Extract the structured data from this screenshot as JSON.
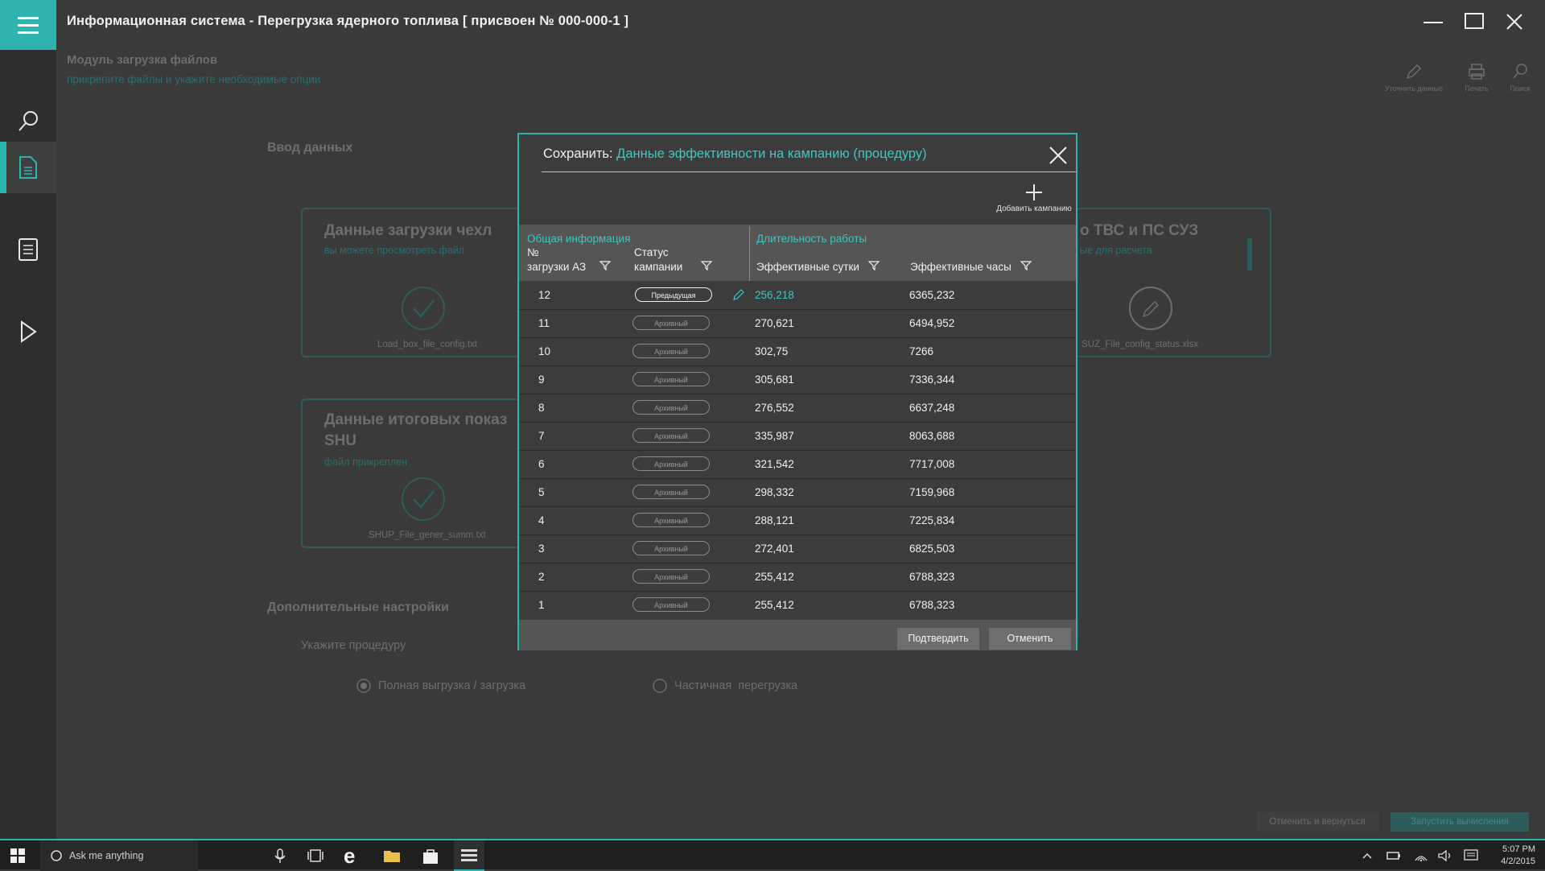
{
  "titlebar": {
    "title": "Информационная система - Перегрузка ядерного топлива [ присвоен № 000-000-1 ]"
  },
  "module": {
    "title": "Модуль загрузка файлов",
    "subtitle": "прикрепите файлы и укажите необходимые опции"
  },
  "toolbar": {
    "refine_label": "Уточнить данные",
    "print_label": "Печать",
    "search_label": "Поиск"
  },
  "input_section": {
    "title": "Ввод данных"
  },
  "cards": {
    "card1": {
      "title": "Данные загрузки чехл",
      "hint": "вы можете просмотреть файл",
      "file": "Load_box_file_config.txt"
    },
    "card2": {
      "title": "Данные итоговых показ",
      "title2": "SHU",
      "hint": "файл прикреплен",
      "file": "SHUP_File_gener_summ.txt"
    },
    "card3": {
      "title": "о ТВС и ПС СУЗ",
      "hint": "ые для расчета",
      "file": "SUZ_File_config_status.xlsx"
    }
  },
  "extra": {
    "title": "Дополнительные настройки",
    "procedure_label": "Укажите процедуру",
    "option_full": "Полная выгрузка / загрузка",
    "option_partial": "Частичная  перегрузка"
  },
  "bottom_buttons": {
    "cancel_return": "Отменить и вернуться",
    "run": "Запустить вычисления"
  },
  "modal": {
    "title_prefix": "Сохранить:",
    "title_link": "Данные эффективности на кампанию (процедуру)",
    "add_campaign": "Добавить кампанию",
    "group_general": "Общая информация",
    "group_duration": "Длительность работы",
    "col_load_1": "№",
    "col_load_2": "загрузки АЗ",
    "col_status_1": "Статус",
    "col_status_2": "кампании",
    "col_days": "Эффективные сутки",
    "col_hours": "Эффективные часы",
    "rows": [
      {
        "num": "12",
        "status": "Предыдущая",
        "days": "256,218",
        "hours": "6365,232"
      },
      {
        "num": "11",
        "status": "Архивный",
        "days": "270,621",
        "hours": "6494,952"
      },
      {
        "num": "10",
        "status": "Архивный",
        "days": "302,75",
        "hours": "7266"
      },
      {
        "num": "9",
        "status": "Архивный",
        "days": "305,681",
        "hours": "7336,344"
      },
      {
        "num": "8",
        "status": "Архивный",
        "days": "276,552",
        "hours": "6637,248"
      },
      {
        "num": "7",
        "status": "Архивный",
        "days": "335,987",
        "hours": "8063,688"
      },
      {
        "num": "6",
        "status": "Архивный",
        "days": "321,542",
        "hours": "7717,008"
      },
      {
        "num": "5",
        "status": "Архивный",
        "days": "298,332",
        "hours": "7159,968"
      },
      {
        "num": "4",
        "status": "Архивный",
        "days": "288,121",
        "hours": "7225,834"
      },
      {
        "num": "3",
        "status": "Архивный",
        "days": "272,401",
        "hours": "6825,503"
      },
      {
        "num": "2",
        "status": "Архивный",
        "days": "255,412",
        "hours": "6788,323"
      },
      {
        "num": "1",
        "status": "Архивный",
        "days": "255,412",
        "hours": "6788,323"
      }
    ],
    "confirm": "Подтвердить",
    "cancel": "Отменить"
  },
  "taskbar": {
    "search_placeholder": "Ask me anything",
    "time": "5:07 PM",
    "date": "4/2/2015"
  },
  "colors": {
    "accent": "#2fb3ae",
    "link": "#3ec6c0",
    "background": "#3a3a3a"
  }
}
